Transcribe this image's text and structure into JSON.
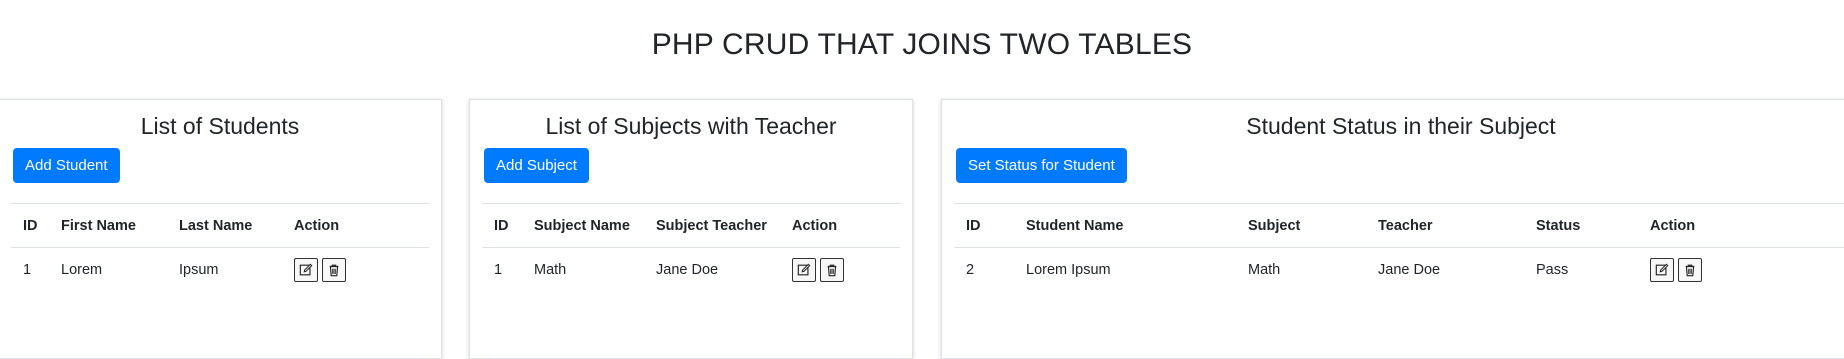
{
  "page": {
    "title": "PHP CRUD THAT JOINS TWO TABLES"
  },
  "students": {
    "title": "List of Students",
    "add_label": "Add Student",
    "headers": {
      "id": "ID",
      "first": "First Name",
      "last": "Last Name",
      "action": "Action"
    },
    "rows": [
      {
        "id": "1",
        "first": "Lorem",
        "last": "Ipsum"
      }
    ]
  },
  "subjects": {
    "title": "List of Subjects with Teacher",
    "add_label": "Add Subject",
    "headers": {
      "id": "ID",
      "subject": "Subject Name",
      "teacher": "Subject Teacher",
      "action": "Action"
    },
    "rows": [
      {
        "id": "1",
        "subject": "Math",
        "teacher": "Jane Doe"
      }
    ]
  },
  "status": {
    "title": "Student Status in their Subject",
    "add_label": "Set Status for Student",
    "headers": {
      "id": "ID",
      "student": "Student Name",
      "subject": "Subject",
      "teacher": "Teacher",
      "status": "Status",
      "action": "Action"
    },
    "rows": [
      {
        "id": "2",
        "student": "Lorem Ipsum",
        "subject": "Math",
        "teacher": "Jane Doe",
        "status": "Pass"
      }
    ]
  },
  "icons": {
    "edit": "edit-icon",
    "delete": "trash-icon"
  },
  "colors": {
    "primary": "#007bff",
    "text": "#212529",
    "border": "#dee2e6"
  }
}
